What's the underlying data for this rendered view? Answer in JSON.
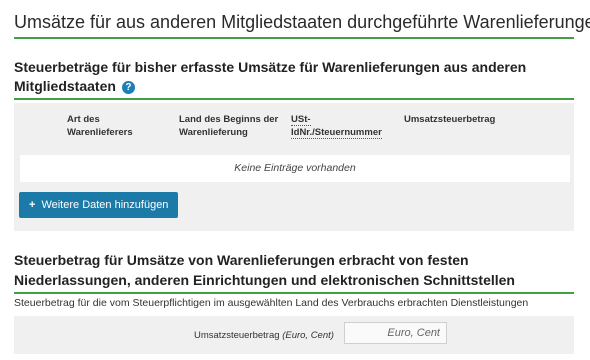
{
  "page": {
    "title": "Umsätze für aus anderen Mitgliedstaaten durchgeführte Warenlieferungen"
  },
  "section1": {
    "heading": "Steuerbeträge für bisher erfasste Umsätze für Warenlieferungen aus anderen Mitgliedstaaten",
    "help_icon": "?",
    "table": {
      "columns": [
        "Art des Warenlieferers",
        "Land des Beginns der Warenlieferung",
        "USt-IdNr./Steuernummer",
        "Umsatzsteuerbetrag"
      ],
      "empty_text": "Keine Einträge vorhanden"
    },
    "add_button": {
      "icon": "+",
      "label": "Weitere Daten hinzufügen"
    }
  },
  "section2": {
    "heading": "Steuerbetrag für Umsätze von Warenlieferungen erbracht von festen Niederlassungen, anderen Einrichtungen und elektronischen Schnittstellen",
    "subtext": "Steuerbetrag für die vom Steuerpflichtigen im ausgewählten Land des Verbrauchs erbrachten Dienstleistungen",
    "field": {
      "label": "Umsatzsteuerbetrag",
      "unit": "(Euro, Cent)",
      "placeholder": "Euro, Cent",
      "value": ""
    }
  },
  "colors": {
    "accent_rule": "#3fa046",
    "button": "#1b7aa8",
    "help_icon": "#1d7fb5",
    "panel": "#f0f0f0"
  }
}
